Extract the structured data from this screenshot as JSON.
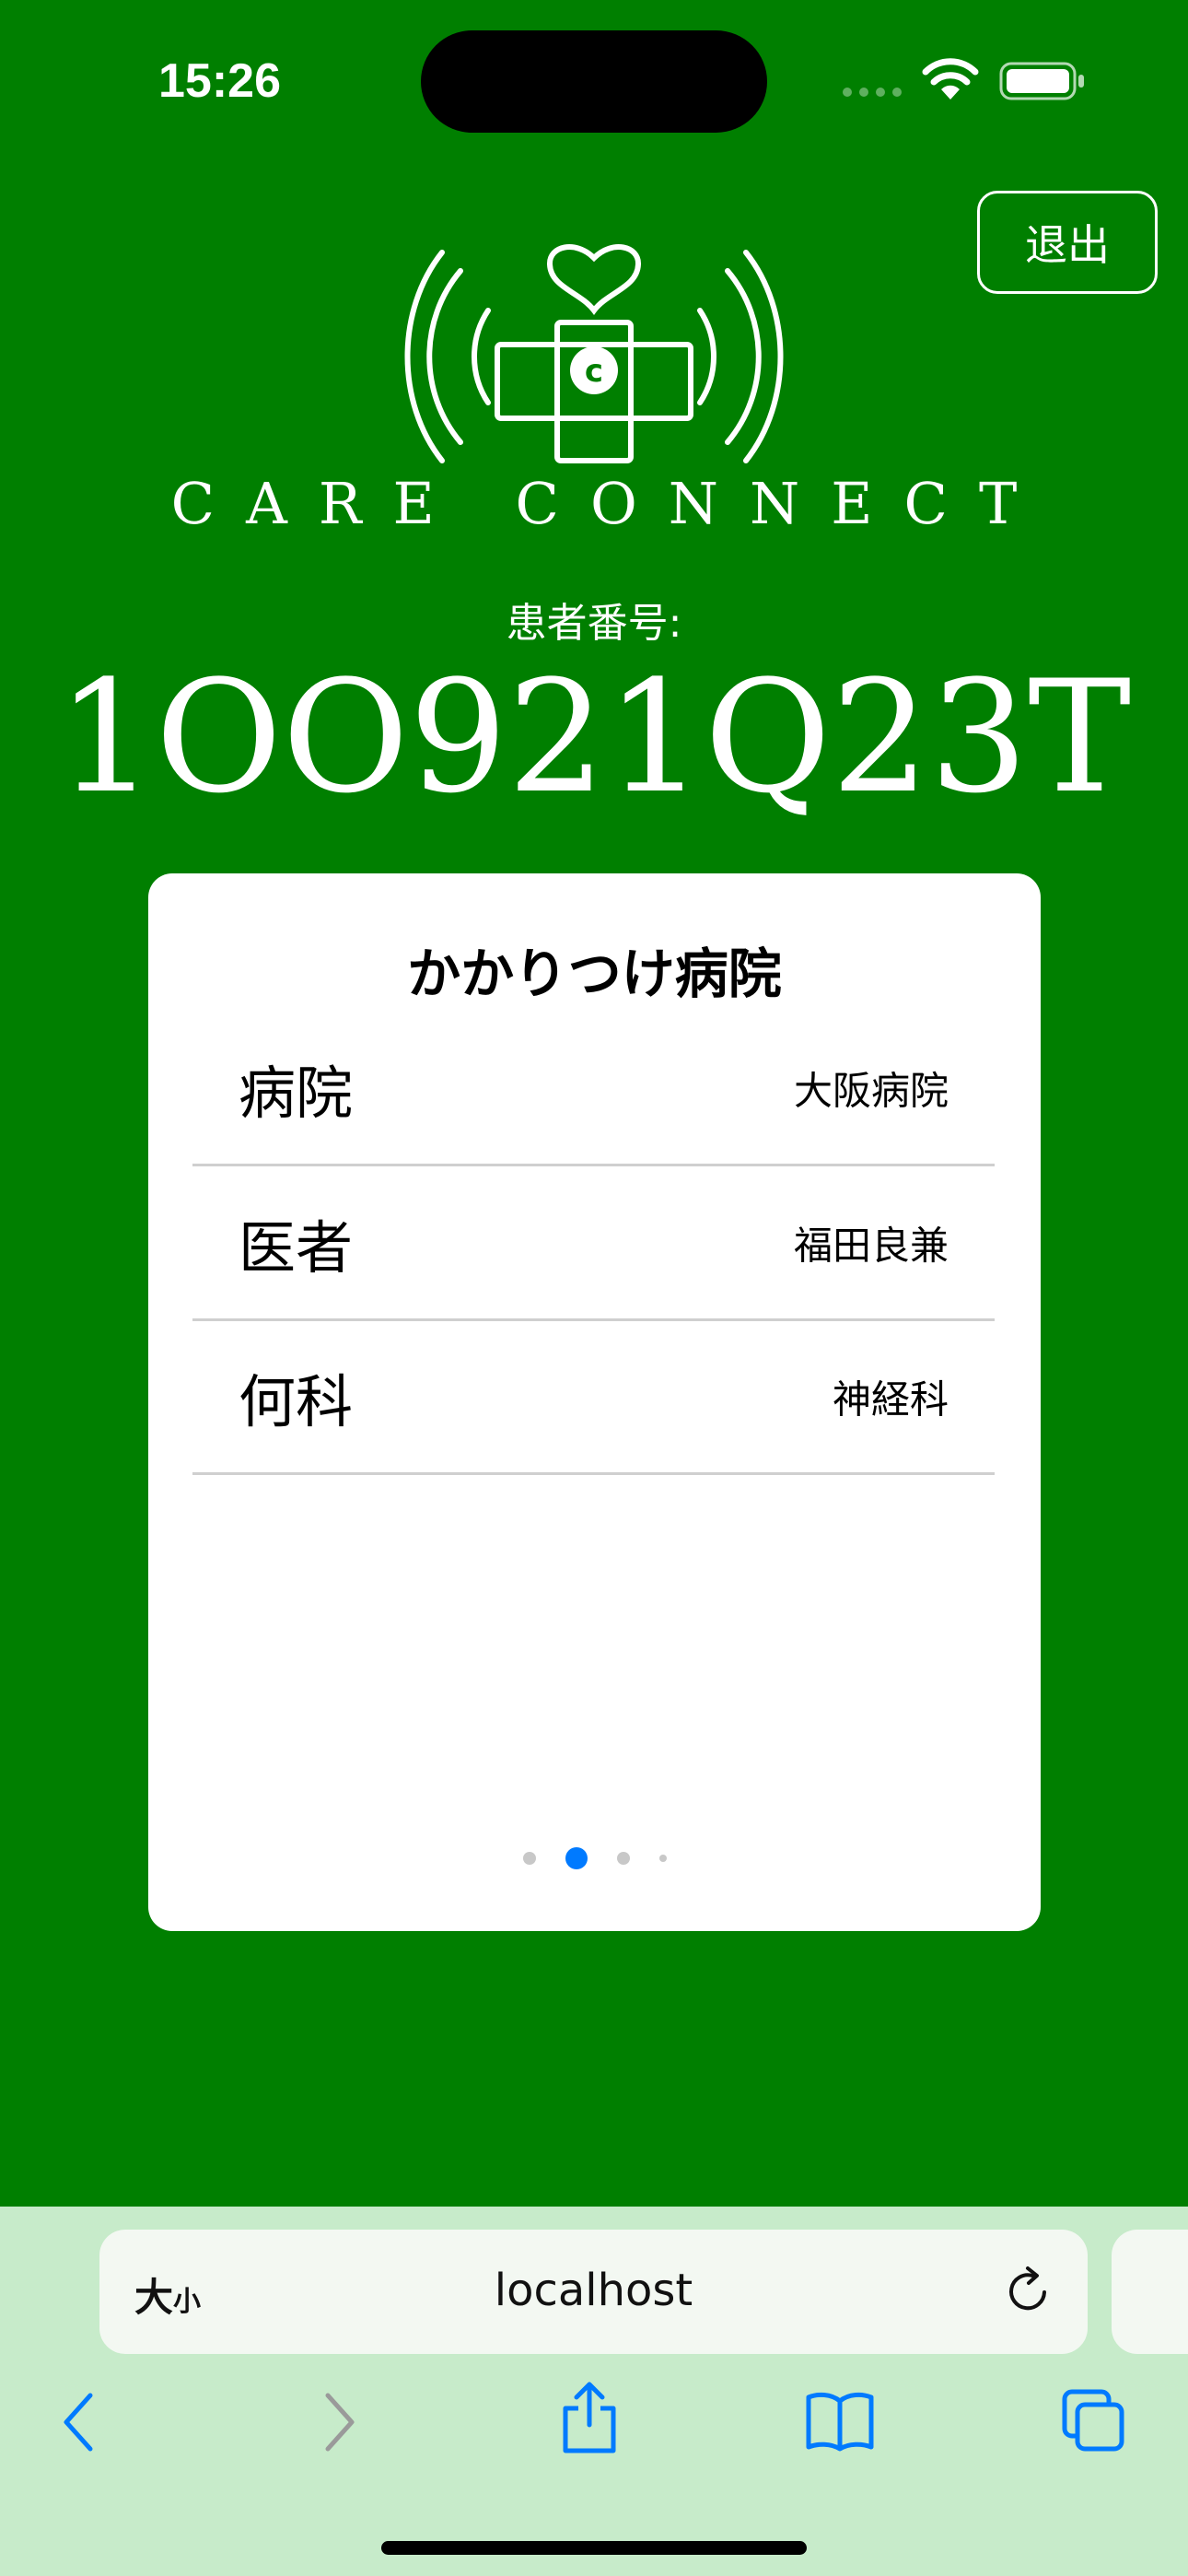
{
  "status_bar": {
    "time": "15:26"
  },
  "header": {
    "logout_label": "退出",
    "brand_name": "CARE CONNECT"
  },
  "patient": {
    "label": "患者番号:",
    "number": "1OO921Q23T"
  },
  "card": {
    "title": "かかりつけ病院",
    "rows": [
      {
        "label": "病院",
        "value": "大阪病院"
      },
      {
        "label": "医者",
        "value": "福田良兼"
      },
      {
        "label": "何科",
        "value": "神経科"
      }
    ],
    "pagination": {
      "total_pages": 4,
      "current_page": 2,
      "active_color": "#007aff"
    }
  },
  "browser": {
    "text_size_big": "大",
    "text_size_small": "小",
    "address": "localhost",
    "accent_color": "#007aff",
    "icons": [
      "back-icon",
      "forward-icon",
      "share-icon",
      "bookmarks-icon",
      "tabs-icon",
      "reload-icon"
    ]
  },
  "colors": {
    "background": "#007f00",
    "card": "#ffffff",
    "browser_bar": "#c7ebca"
  }
}
